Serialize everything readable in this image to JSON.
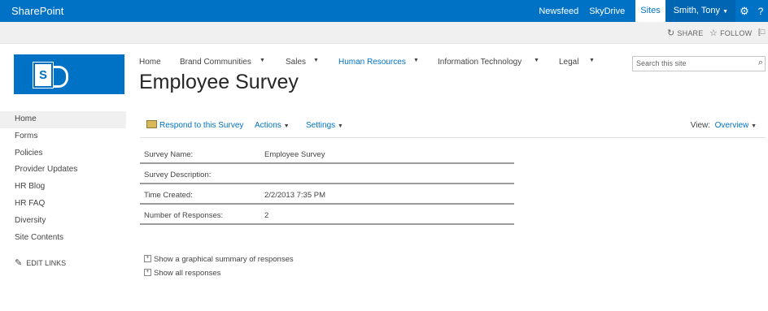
{
  "suite_bar": {
    "brand": "SharePoint",
    "links": [
      "Newsfeed",
      "SkyDrive",
      "Sites"
    ],
    "user": "Smith, Tony",
    "help": "?"
  },
  "action_bar": {
    "share": "SHARE",
    "follow": "FOLLOW"
  },
  "global_nav": [
    {
      "label": "Home"
    },
    {
      "label": "Brand Communities"
    },
    {
      "label": "Sales"
    },
    {
      "label": "Human Resources"
    },
    {
      "label": "Information Technology"
    },
    {
      "label": "Legal"
    }
  ],
  "search": {
    "placeholder": "Search this site"
  },
  "page_title": "Employee Survey",
  "quick_launch": {
    "items": [
      "Home",
      "Forms",
      "Policies",
      "Provider Updates",
      "HR Blog",
      "HR FAQ",
      "Diversity",
      "Site Contents"
    ],
    "edit_links": "EDIT LINKS"
  },
  "toolbar": {
    "respond": "Respond to this Survey",
    "actions": "Actions",
    "settings": "Settings",
    "view_label": "View:",
    "view_value": "Overview"
  },
  "properties": [
    {
      "key": "Survey Name:",
      "value": "Employee Survey"
    },
    {
      "key": "Survey Description:",
      "value": ""
    },
    {
      "key": "Time Created:",
      "value": "2/2/2013 7:35 PM"
    },
    {
      "key": "Number of Responses:",
      "value": "2"
    }
  ],
  "response_links": {
    "graphical": "Show a graphical summary of responses",
    "all": "Show all responses"
  },
  "colors": {
    "accent": "#0072c6",
    "suite_bar": "#0072c6"
  }
}
